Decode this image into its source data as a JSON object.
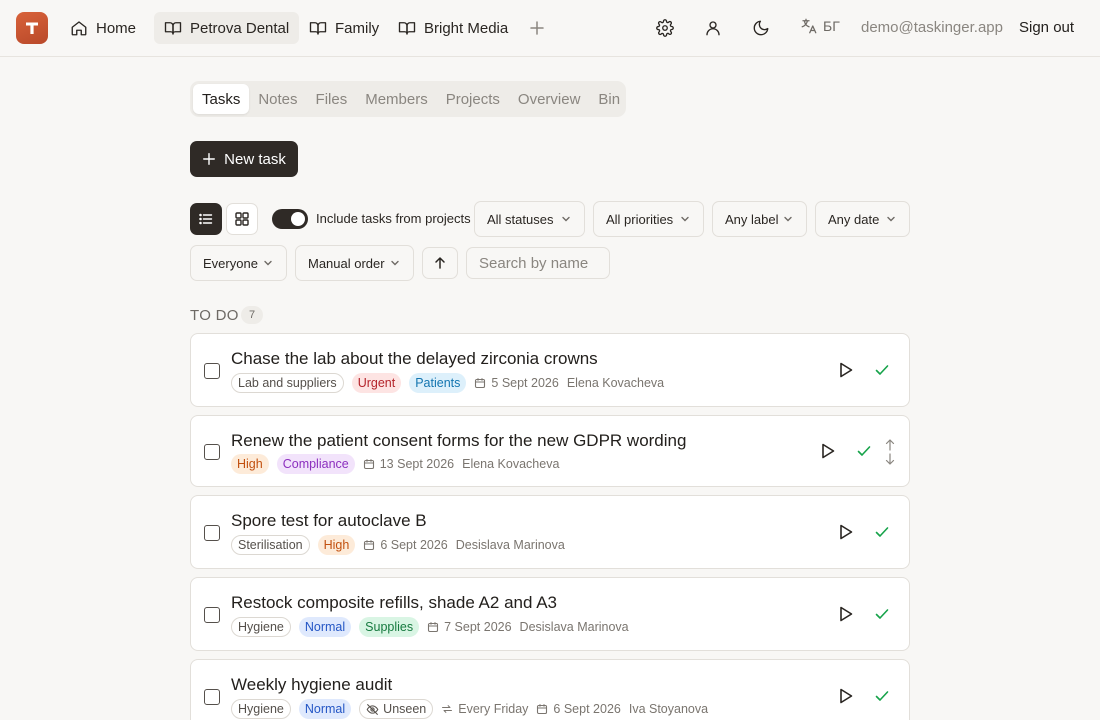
{
  "app": {
    "logo_letter": "T",
    "nav": [
      {
        "label": "Home",
        "icon": "home-icon"
      },
      {
        "label": "Petrova Dental",
        "icon": "book-icon",
        "active": true
      },
      {
        "label": "Family",
        "icon": "book-icon"
      },
      {
        "label": "Bright Media",
        "icon": "book-icon"
      }
    ],
    "language": "БГ",
    "email": "demo@taskinger.app",
    "sign_out": "Sign out"
  },
  "tabs": [
    "Tasks",
    "Notes",
    "Files",
    "Members",
    "Projects",
    "Overview",
    "Bin"
  ],
  "active_tab": "Tasks",
  "new_task_label": "New task",
  "filters": {
    "include_projects_label": "Include tasks from projects",
    "include_projects_on": true,
    "status": "All statuses",
    "priority": "All priorities",
    "label": "Any label",
    "date": "Any date",
    "assignee": "Everyone",
    "order": "Manual order",
    "search_placeholder": "Search by name"
  },
  "section": {
    "title": "TO DO",
    "count": "7"
  },
  "tasks": [
    {
      "title": "Chase the lab about the delayed zirconia crowns",
      "chips": [
        {
          "text": "Lab and suppliers",
          "style": "outline"
        },
        {
          "text": "Urgent",
          "style": "urgent"
        },
        {
          "text": "Patients",
          "style": "patients"
        }
      ],
      "date": "5 Sept 2026",
      "assignee": "Elena Kovacheva"
    },
    {
      "title": "Renew the patient consent forms for the new GDPR wording",
      "chips": [
        {
          "text": "High",
          "style": "high"
        },
        {
          "text": "Compliance",
          "style": "compliance"
        }
      ],
      "date": "13 Sept 2026",
      "assignee": "Elena Kovacheva"
    },
    {
      "title": "Spore test for autoclave B",
      "chips": [
        {
          "text": "Sterilisation",
          "style": "outline"
        },
        {
          "text": "High",
          "style": "high"
        }
      ],
      "date": "6 Sept 2026",
      "assignee": "Desislava Marinova"
    },
    {
      "title": "Restock composite refills, shade A2 and A3",
      "chips": [
        {
          "text": "Hygiene",
          "style": "outline"
        },
        {
          "text": "Normal",
          "style": "normal"
        },
        {
          "text": "Supplies",
          "style": "supplies"
        }
      ],
      "date": "7 Sept 2026",
      "assignee": "Desislava Marinova"
    },
    {
      "title": "Weekly hygiene audit",
      "chips": [
        {
          "text": "Hygiene",
          "style": "outline"
        },
        {
          "text": "Normal",
          "style": "normal"
        }
      ],
      "unseen": "Unseen",
      "recurrence": "Every Friday",
      "date": "6 Sept 2026",
      "assignee": "Iva Stoyanova"
    }
  ],
  "colors": {
    "background": "#f8f7f5",
    "primary_dark": "#2f2a26",
    "brand": "#c9552f",
    "check_green": "#16a34a"
  }
}
